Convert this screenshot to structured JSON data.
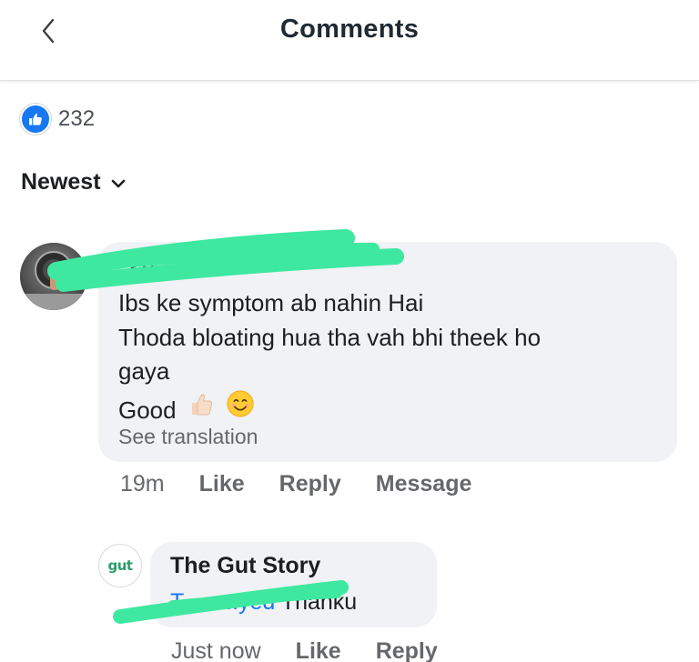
{
  "header": {
    "title": "Comments"
  },
  "reactions": {
    "count": "232",
    "icon": "thumbs-up-icon",
    "badge_color": "#1877f2"
  },
  "sort": {
    "label": "Newest"
  },
  "comments": [
    {
      "author_visible": "..t Syed",
      "lines": [
        "Ibs ke symptom ab nahin Hai",
        "Thoda bloating hua tha vah bhi theek ho",
        "gaya",
        "Good"
      ],
      "emojis": [
        "thumbs-up",
        "smiling-face"
      ],
      "see_translation": "See translation",
      "time": "19m",
      "actions": [
        "Like",
        "Reply",
        "Message"
      ]
    }
  ],
  "reply": {
    "author": "The Gut Story",
    "avatar_text": "gut",
    "mention_visible": "T.........yed",
    "text": "Thanku",
    "time": "Just now",
    "actions": [
      "Like",
      "Reply"
    ]
  },
  "colors": {
    "bubble": "#f0f2f5",
    "meta_text": "#65676b",
    "redaction": "#3ee8a0",
    "brand_green": "#2a9d6a"
  }
}
